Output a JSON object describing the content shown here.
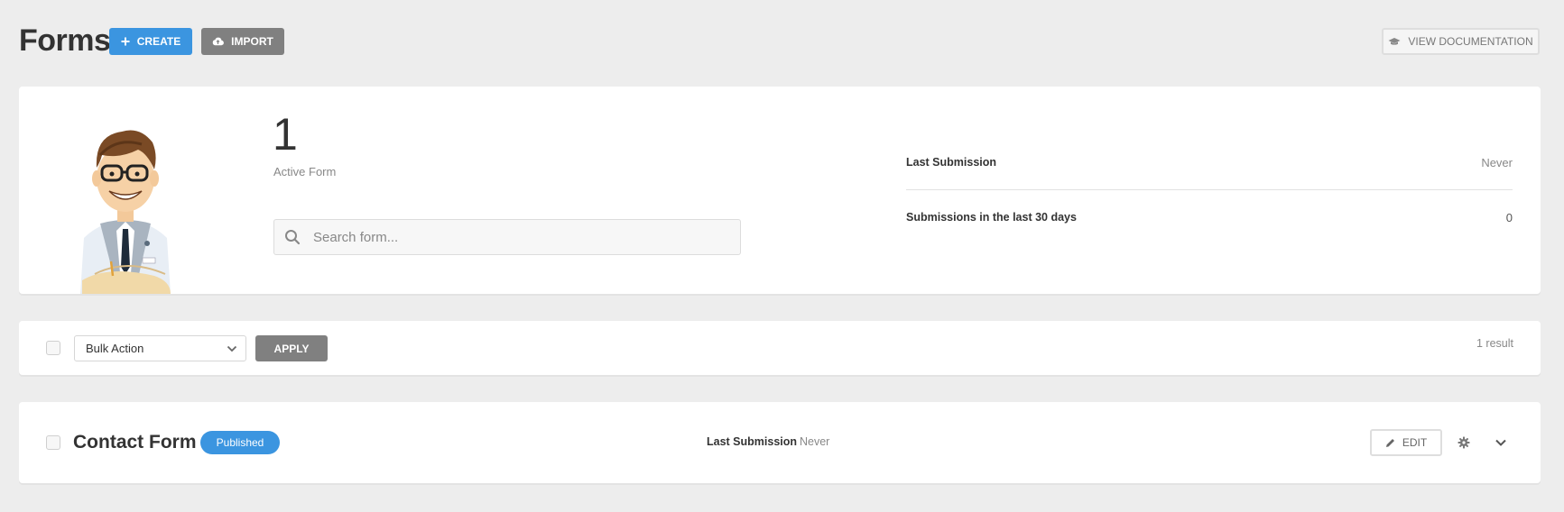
{
  "header": {
    "title": "Forms",
    "create_label": "Create",
    "import_label": "Import",
    "docs_label": "View Documentation"
  },
  "summary": {
    "active_count": "1",
    "active_label": "Active Form",
    "search_placeholder": "Search form...",
    "stats": [
      {
        "label": "Last Submission",
        "value": "Never"
      },
      {
        "label": "Submissions in the last 30 days",
        "value": "0"
      }
    ]
  },
  "bulk": {
    "select_value": "Bulk Action",
    "apply_label": "Apply",
    "results": "1 result"
  },
  "forms": [
    {
      "name": "Contact Form",
      "status": "Published",
      "last_submission_label": "Last Submission",
      "last_submission_value": "Never",
      "edit_label": "Edit"
    }
  ],
  "colors": {
    "accent": "#3b95e0",
    "secondary_button": "#808080",
    "background": "#ededed"
  },
  "icons": [
    "plus-icon",
    "cloud-upload-icon",
    "graduation-cap-icon",
    "search-icon",
    "chevron-down-icon",
    "pencil-icon",
    "gear-icon"
  ]
}
